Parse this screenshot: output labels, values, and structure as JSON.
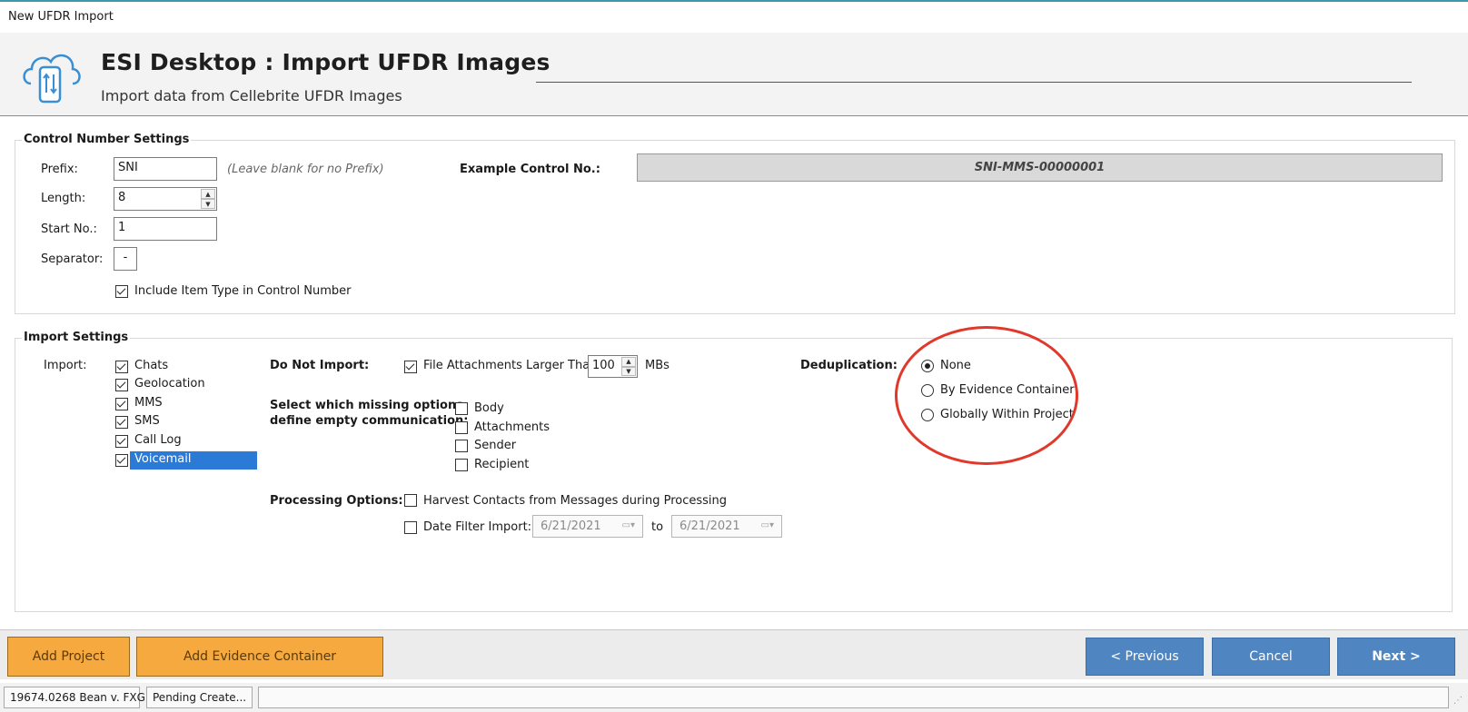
{
  "window": {
    "title": "New UFDR Import"
  },
  "header": {
    "title": "ESI Desktop : Import UFDR Images",
    "subtitle": "Import data from Cellebrite UFDR Images"
  },
  "control_number": {
    "legend": "Control Number Settings",
    "prefix_label": "Prefix:",
    "prefix_value": "SNI",
    "prefix_hint": "(Leave blank for no Prefix)",
    "length_label": "Length:",
    "length_value": "8",
    "start_label": "Start No.:",
    "start_value": "1",
    "separator_label": "Separator:",
    "separator_value": "-",
    "example_label": "Example Control No.:",
    "example_value": "SNI-MMS-00000001",
    "include_type_label": "Include Item Type in Control Number",
    "include_type_checked": true
  },
  "import_settings": {
    "legend": "Import Settings",
    "import_label": "Import:",
    "import_items": [
      {
        "label": "Chats",
        "checked": true
      },
      {
        "label": "Geolocation",
        "checked": true
      },
      {
        "label": "MMS",
        "checked": true
      },
      {
        "label": "SMS",
        "checked": true
      },
      {
        "label": "Call Log",
        "checked": true
      },
      {
        "label": "Voicemail",
        "checked": true,
        "selected": true
      }
    ],
    "do_not_import_label": "Do Not Import:",
    "attachments_label": "File Attachments Larger Than",
    "attachments_value": "100",
    "attachments_unit": "MBs",
    "missing_label_line1": "Select which missing options",
    "missing_label_line2": "define empty communication:",
    "missing_options": [
      {
        "label": "Body",
        "checked": false
      },
      {
        "label": "Attachments",
        "checked": false
      },
      {
        "label": "Sender",
        "checked": false
      },
      {
        "label": "Recipient",
        "checked": false
      }
    ],
    "processing_label": "Processing Options:",
    "harvest_label": "Harvest Contacts from Messages during Processing",
    "date_filter_label": "Date Filter Import:",
    "date_from": "6/21/2021",
    "date_to_label": "to",
    "date_to": "6/21/2021",
    "dedup_label": "Deduplication:",
    "dedup_options": [
      {
        "label": "None",
        "selected": true
      },
      {
        "label": "By Evidence Container",
        "selected": false
      },
      {
        "label": "Globally Within Project",
        "selected": false
      }
    ]
  },
  "footer": {
    "add_project": "Add Project",
    "add_evidence": "Add Evidence Container",
    "previous": "< Previous",
    "cancel": "Cancel",
    "next": "Next >"
  },
  "status": {
    "case": "19674.0268 Bean v. FXG",
    "state": "Pending Create...",
    "extra": ""
  },
  "colors": {
    "accent_orange": "#f5a93e",
    "button_blue": "#4f86c1",
    "selection_blue": "#2a7ad6",
    "annotation_red": "#e0382a"
  }
}
